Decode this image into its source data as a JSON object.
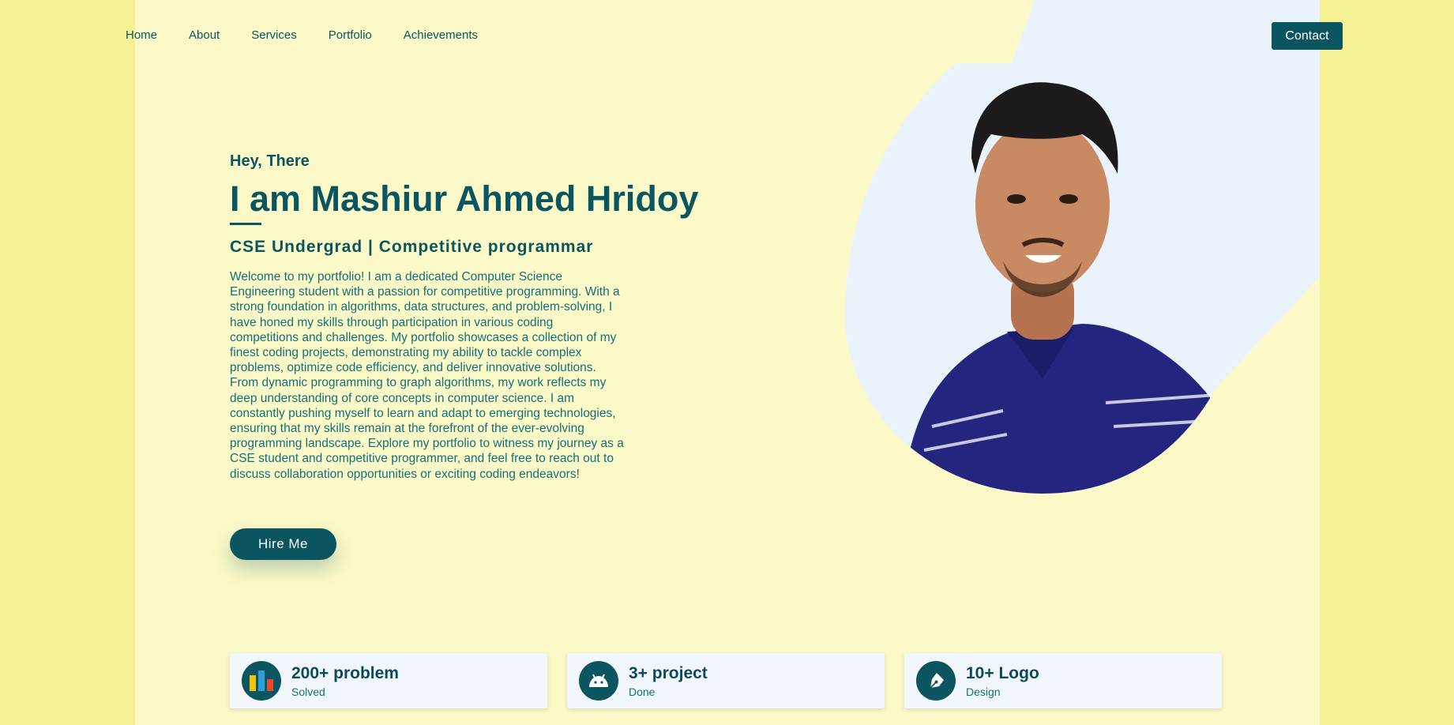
{
  "nav": {
    "items": [
      "Home",
      "About",
      "Services",
      "Portfolio",
      "Achievements"
    ],
    "contact_label": "Contact"
  },
  "hero": {
    "greeting": "Hey, There",
    "name": "I am Mashiur Ahmed Hridoy",
    "subtitle": "CSE Undergrad | Competitive programmar",
    "bio": "Welcome to my portfolio! I am a dedicated Computer Science Engineering student with a passion for competitive programming. With a strong foundation in algorithms, data structures, and problem-solving, I have honed my skills through participation in various coding competitions and challenges. My portfolio showcases a collection of my finest coding projects, demonstrating my ability to tackle complex problems, optimize code efficiency, and deliver innovative solutions. From dynamic programming to graph algorithms, my work reflects my deep understanding of core concepts in computer science. I am constantly pushing myself to learn and adapt to emerging technologies, ensuring that my skills remain at the forefront of the ever-evolving programming landscape. Explore my portfolio to witness my journey as a CSE student and competitive programmer, and feel free to reach out to discuss collaboration opportunities or exciting coding endeavors!",
    "hire_label": "Hire Me"
  },
  "stats": [
    {
      "value": "200+ problem",
      "label": "Solved",
      "icon": "bar-chart-icon"
    },
    {
      "value": "3+ project",
      "label": "Done",
      "icon": "android-icon"
    },
    {
      "value": "10+ Logo",
      "label": "Design",
      "icon": "pen-nib-icon"
    }
  ],
  "colors": {
    "outer_bg": "#f7f196",
    "page_bg": "#fbf9c7",
    "accent": "#0b5560",
    "blob": "#eaf3fb",
    "shirt": "#24257f"
  }
}
